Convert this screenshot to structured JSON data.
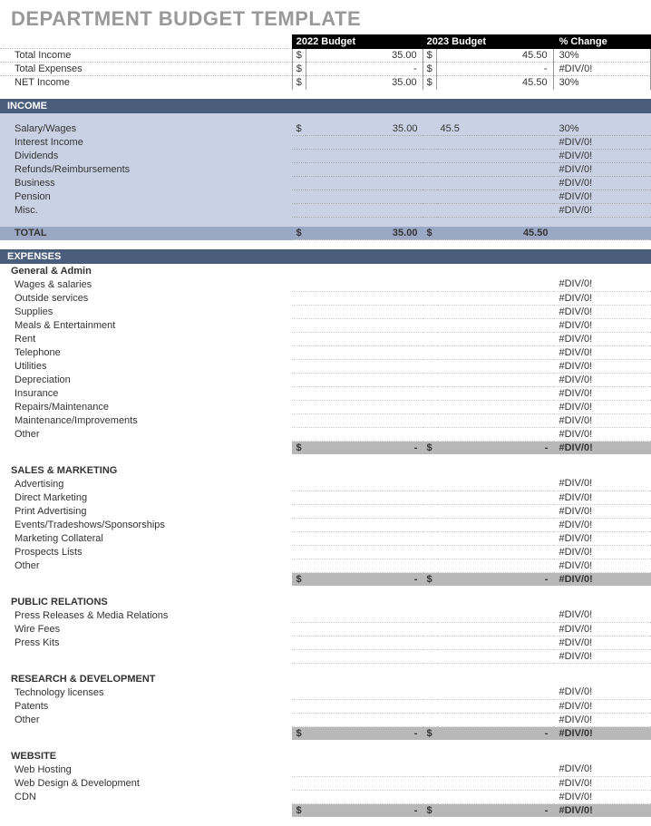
{
  "title": "DEPARTMENT BUDGET TEMPLATE",
  "headers": {
    "y1": "2022 Budget",
    "y2": "2023 Budget",
    "chg": "% Change"
  },
  "currency": "$",
  "dash": "-",
  "div0": "#DIV/0!",
  "summary": [
    {
      "label": "Total Income",
      "v1": "35.00",
      "v2": "45.50",
      "chg": "30%"
    },
    {
      "label": "Total Expenses",
      "v1": "-",
      "v2": "-",
      "chg": "#DIV/0!"
    },
    {
      "label": "NET Income",
      "v1": "35.00",
      "v2": "45.50",
      "chg": "30%"
    }
  ],
  "income": {
    "title": "INCOME",
    "rows": [
      {
        "label": "Salary/Wages",
        "sym1": "$",
        "v1": "35.00",
        "v2": "45.5",
        "chg": "30%"
      },
      {
        "label": "Interest Income",
        "chg": "#DIV/0!"
      },
      {
        "label": "Dividends",
        "chg": "#DIV/0!"
      },
      {
        "label": "Refunds/Reimbursements",
        "chg": "#DIV/0!"
      },
      {
        "label": "Business",
        "chg": "#DIV/0!"
      },
      {
        "label": "Pension",
        "chg": "#DIV/0!"
      },
      {
        "label": "Misc.",
        "chg": "#DIV/0!"
      }
    ],
    "total": {
      "label": "TOTAL",
      "v1": "35.00",
      "v2": "45.50"
    }
  },
  "expenses": {
    "title": "EXPENSES",
    "categories": [
      {
        "name": "General & Admin",
        "rows": [
          {
            "label": "Wages & salaries",
            "chg": "#DIV/0!"
          },
          {
            "label": "Outside services",
            "chg": "#DIV/0!"
          },
          {
            "label": "Supplies",
            "chg": "#DIV/0!"
          },
          {
            "label": "Meals & Entertainment",
            "chg": "#DIV/0!"
          },
          {
            "label": "Rent",
            "chg": "#DIV/0!"
          },
          {
            "label": "Telephone",
            "chg": "#DIV/0!"
          },
          {
            "label": "Utilities",
            "chg": "#DIV/0!"
          },
          {
            "label": "Depreciation",
            "chg": "#DIV/0!"
          },
          {
            "label": "Insurance",
            "chg": "#DIV/0!"
          },
          {
            "label": "Repairs/Maintenance",
            "chg": "#DIV/0!"
          },
          {
            "label": "Maintenance/Improvements",
            "chg": "#DIV/0!"
          },
          {
            "label": "Other",
            "chg": "#DIV/0!"
          }
        ],
        "subtotal": {
          "v1": "-",
          "v2": "-",
          "chg": "#DIV/0!"
        }
      },
      {
        "name": "SALES & MARKETING",
        "rows": [
          {
            "label": "Advertising",
            "chg": "#DIV/0!"
          },
          {
            "label": "Direct Marketing",
            "chg": "#DIV/0!"
          },
          {
            "label": "Print Advertising",
            "chg": "#DIV/0!"
          },
          {
            "label": "Events/Tradeshows/Sponsorships",
            "chg": "#DIV/0!"
          },
          {
            "label": "Marketing Collateral",
            "chg": "#DIV/0!"
          },
          {
            "label": "Prospects Lists",
            "chg": "#DIV/0!"
          },
          {
            "label": "Other",
            "chg": "#DIV/0!"
          }
        ],
        "subtotal": {
          "v1": "-",
          "v2": "-",
          "chg": "#DIV/0!"
        }
      },
      {
        "name": "PUBLIC RELATIONS",
        "rows": [
          {
            "label": "Press Releases & Media Relations",
            "chg": "#DIV/0!"
          },
          {
            "label": "Wire Fees",
            "chg": "#DIV/0!"
          },
          {
            "label": "Press Kits",
            "chg": "#DIV/0!"
          },
          {
            "label": "",
            "chg": "#DIV/0!"
          }
        ],
        "subtotal": null
      },
      {
        "name": "RESEARCH & DEVELOPMENT",
        "rows": [
          {
            "label": "Technology licenses",
            "chg": "#DIV/0!"
          },
          {
            "label": "Patents",
            "chg": "#DIV/0!"
          },
          {
            "label": "Other",
            "chg": "#DIV/0!"
          }
        ],
        "subtotal": {
          "v1": "-",
          "v2": "-",
          "chg": "#DIV/0!"
        }
      },
      {
        "name": "WEBSITE",
        "rows": [
          {
            "label": "Web Hosting",
            "chg": "#DIV/0!"
          },
          {
            "label": "Web Design & Development",
            "chg": "#DIV/0!"
          },
          {
            "label": "CDN",
            "chg": "#DIV/0!"
          }
        ],
        "subtotal": {
          "v1": "-",
          "v2": "-",
          "chg": "#DIV/0!"
        }
      }
    ]
  }
}
